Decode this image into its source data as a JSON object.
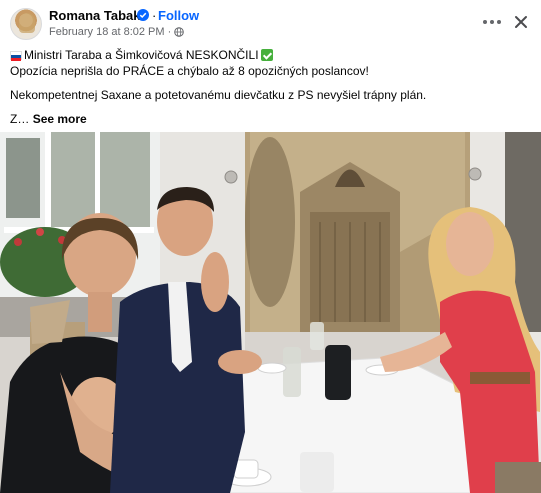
{
  "post": {
    "author": "Romana Tabak",
    "follow_label": "Follow",
    "separator": "·",
    "timestamp": "February 18 at 8:02 PM",
    "meta_dot": "·",
    "line1_text": "Ministri Taraba a Šimkovičová  NESKONČILI",
    "line2_text": "Opozícia neprišla do PRÁCE a chýbalo až 8 opozičných poslancov!",
    "line3_text": "Nekompetentnej Saxane a potetovanému dievčatku z PS nevyšiel trápny plán.",
    "line4_prefix": "Z…",
    "see_more_label": "See more"
  },
  "icons": {
    "verified": "verified-badge-icon",
    "globe": "globe-icon",
    "more": "more-options-icon",
    "close": "close-icon",
    "flag": "slovakia-flag-icon",
    "check": "green-check-icon"
  },
  "colors": {
    "link_blue": "#0866ff",
    "meta_gray": "#65676b",
    "check_green": "#46b03c"
  }
}
